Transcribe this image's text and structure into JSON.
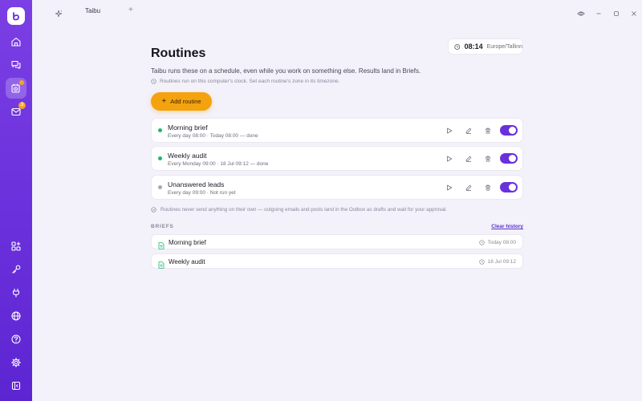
{
  "app": {
    "tab_title": "Taibu"
  },
  "colors": {
    "accent": "#6a30db",
    "orange": "#f5a20f",
    "green": "#22b573",
    "gray": "#a9a6b5"
  },
  "sidebar": {
    "items": [
      {
        "name": "home",
        "icon": "home-icon"
      },
      {
        "name": "chat",
        "icon": "chat-icon"
      },
      {
        "name": "routines",
        "icon": "calendar-clock-icon",
        "active": true
      },
      {
        "name": "inbox",
        "icon": "inbox-icon",
        "badge": "3"
      },
      {
        "name": "apps",
        "icon": "grid-plus-icon"
      },
      {
        "name": "keys",
        "icon": "key-icon"
      },
      {
        "name": "plugins",
        "icon": "plug-icon"
      },
      {
        "name": "globe",
        "icon": "globe-icon"
      },
      {
        "name": "help",
        "icon": "help-icon"
      },
      {
        "name": "settings",
        "icon": "gear-icon"
      },
      {
        "name": "collapse",
        "icon": "sidebar-collapse-icon"
      }
    ]
  },
  "clock": {
    "time": "08:14",
    "timezone": "Europe/Tallinn"
  },
  "page": {
    "title": "Routines",
    "subtitle": "Taibu runs these on a schedule, even while you work on something else. Results land in Briefs.",
    "hint": "Routines run on this computer's clock. Set each routine's zone in its timezone.",
    "add_label": "Add routine",
    "note": "Routines never send anything on their own — outgoing emails and posts land in the Outbox as drafts and wait for your approval."
  },
  "routines": [
    {
      "name": "Morning brief",
      "schedule": "Every day 08:00 · Today 08:00 — done",
      "status": "done",
      "enabled": true
    },
    {
      "name": "Weekly audit",
      "schedule": "Every Monday 09:00 · 18 Jul 09:12 — done",
      "status": "done",
      "enabled": true
    },
    {
      "name": "Unanswered leads",
      "schedule": "Every day 09:00 · Not run yet",
      "status": "pending",
      "enabled": true
    }
  ],
  "briefs": {
    "heading": "BRIEFS",
    "clear_label": "Clear history",
    "items": [
      {
        "name": "Morning brief",
        "time": "Today 08:00"
      },
      {
        "name": "Weekly audit",
        "time": "18 Jul 09:12"
      }
    ]
  }
}
